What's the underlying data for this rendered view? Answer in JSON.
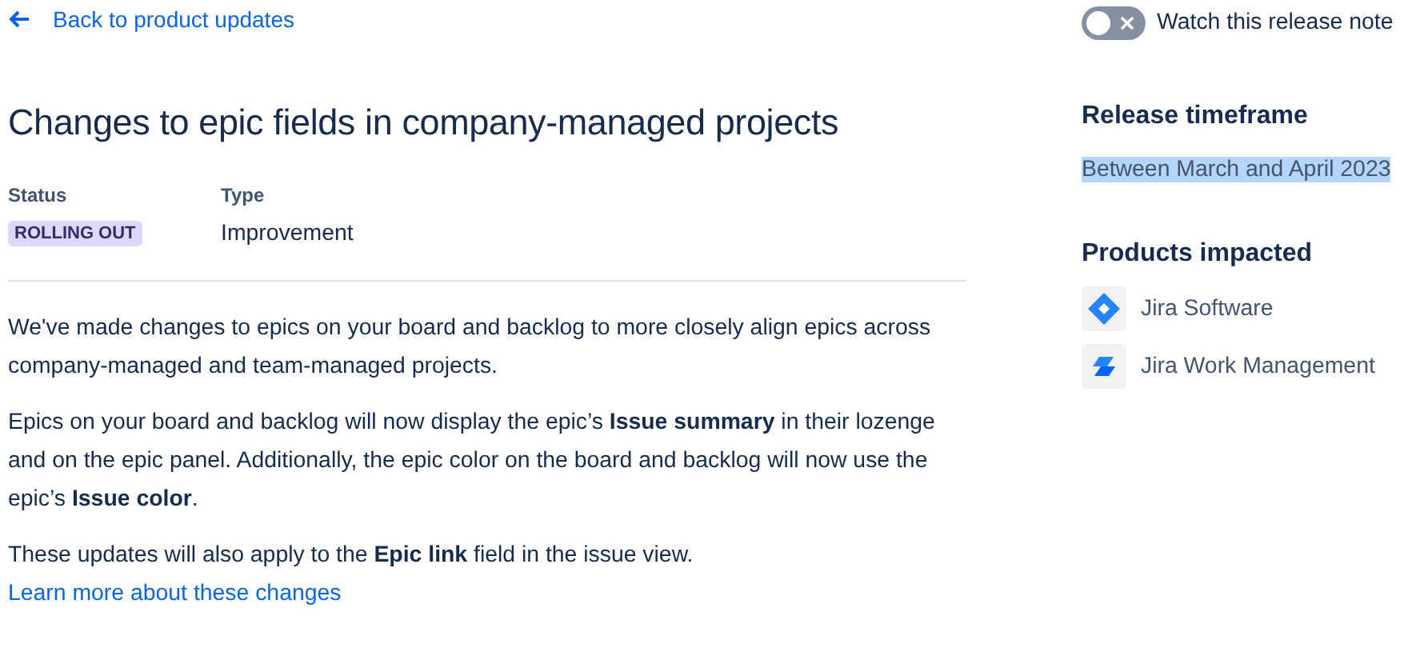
{
  "back_link": {
    "label": "Back to product updates"
  },
  "title": "Changes to epic fields in company-managed projects",
  "meta": [
    {
      "label": "Status",
      "value": "ROLLING OUT",
      "kind": "lozenge"
    },
    {
      "label": "Type",
      "value": "Improvement",
      "kind": "text"
    }
  ],
  "body": [
    {
      "text": "We've made changes to epics on your board and backlog to more closely align epics across company-managed and team-managed projects."
    },
    {
      "text": "Epics on your board and backlog will now display the epic’s **Issue summary** in their lozenge and on the epic panel. Additionally, the epic color on the board and backlog will now use the epic’s **Issue color**."
    },
    {
      "text": "These updates will also apply to the **Epic link** field in the issue view.",
      "link": "Learn more about these changes"
    }
  ],
  "watch_toggle": {
    "label": "Watch this release note",
    "on": false
  },
  "release_timeframe": {
    "heading": "Release timeframe",
    "value": "Between March and April 2023",
    "highlighted": true
  },
  "products_impacted": {
    "heading": "Products impacted",
    "items": [
      {
        "name": "Jira Software",
        "kind": "software"
      },
      {
        "name": "Jira Work Management",
        "kind": "work-management"
      }
    ]
  }
}
